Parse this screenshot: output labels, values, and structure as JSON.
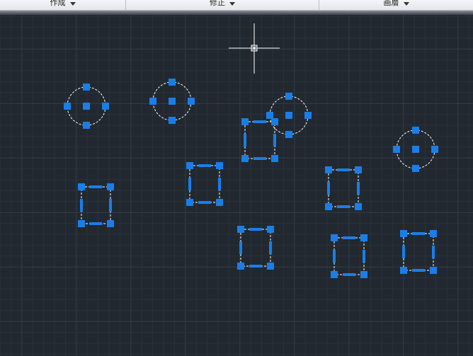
{
  "ribbon": {
    "panels": [
      {
        "label": "作成"
      },
      {
        "label": "修正"
      },
      {
        "label": "画層"
      }
    ]
  },
  "colors": {
    "background": "#212830",
    "grid_minor": "#2b323b",
    "grid_major": "#343c47",
    "grip": "#1a7ee8",
    "entity": "#ffffff"
  },
  "icons": {
    "cursor": "crosshair-cursor-icon",
    "dropdown": "chevron-down-icon"
  }
}
